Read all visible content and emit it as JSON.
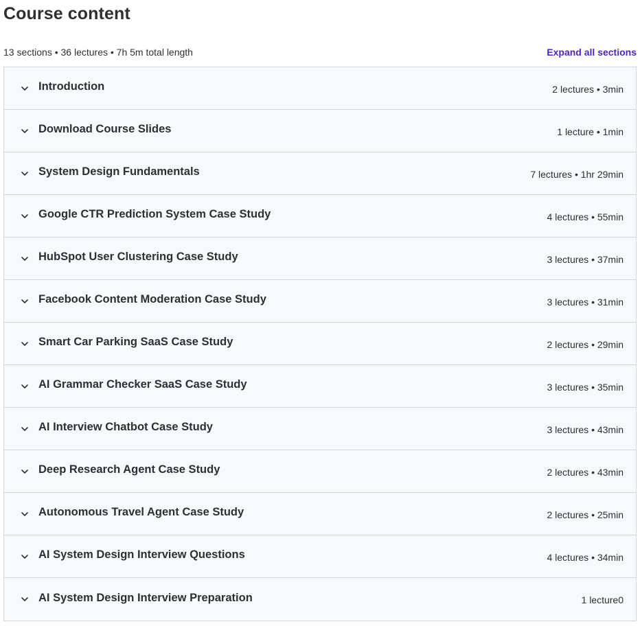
{
  "header": {
    "title": "Course content",
    "summary": "13 sections • 36 lectures • 7h 5m total length",
    "expand_label": "Expand all sections"
  },
  "icons": {
    "section_toggle": "chevron-down-icon"
  },
  "colors": {
    "link": "#5022c3",
    "row_background": "#f7f9fa",
    "border": "#d1d7dc",
    "text": "#2d2f31"
  },
  "sections": [
    {
      "title": "Introduction",
      "meta": "2 lectures • 3min"
    },
    {
      "title": "Download Course Slides",
      "meta": "1 lecture • 1min"
    },
    {
      "title": "System Design Fundamentals",
      "meta": "7 lectures • 1hr 29min"
    },
    {
      "title": "Google CTR Prediction System Case Study",
      "meta": "4 lectures • 55min"
    },
    {
      "title": "HubSpot User Clustering Case Study",
      "meta": "3 lectures • 37min"
    },
    {
      "title": "Facebook Content Moderation Case Study",
      "meta": "3 lectures • 31min"
    },
    {
      "title": "Smart Car Parking SaaS Case Study",
      "meta": "2 lectures • 29min"
    },
    {
      "title": "AI Grammar Checker SaaS Case Study",
      "meta": "3 lectures • 35min"
    },
    {
      "title": "AI Interview Chatbot Case Study",
      "meta": "3 lectures • 43min"
    },
    {
      "title": "Deep Research Agent Case Study",
      "meta": "2 lectures • 43min"
    },
    {
      "title": "Autonomous Travel Agent Case Study",
      "meta": "2 lectures • 25min"
    },
    {
      "title": "AI System Design Interview Questions",
      "meta": "4 lectures • 34min"
    },
    {
      "title": "AI System Design Interview Preparation",
      "meta": "1 lecture0"
    }
  ]
}
